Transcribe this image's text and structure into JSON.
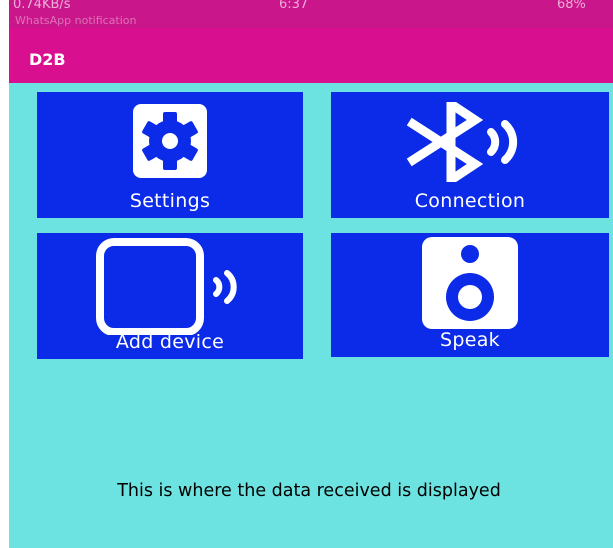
{
  "status_bar": {
    "network_speed": "0.74KB/s",
    "time": "6:37",
    "battery": "68%",
    "notification": "WhatsApp notification"
  },
  "app": {
    "title": "D2B"
  },
  "tiles": [
    {
      "label": "Settings",
      "icon": "gear-icon"
    },
    {
      "label": "Connection",
      "icon": "bluetooth-icon"
    },
    {
      "label": "Add device",
      "icon": "phone-signal-icon"
    },
    {
      "label": "Speak",
      "icon": "speaker-icon"
    }
  ],
  "display": {
    "text": "This is where the data received is displayed"
  },
  "colors": {
    "status_bar": "#c9168a",
    "app_bar": "#d8108f",
    "background": "#6ce3e0",
    "tile": "#0b2be8",
    "tile_text": "#ffffff"
  }
}
